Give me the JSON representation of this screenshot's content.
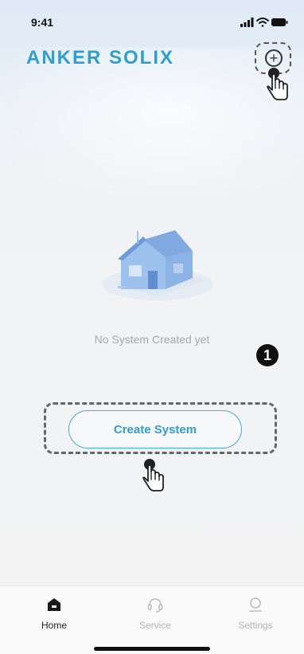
{
  "status_bar": {
    "time": "9:41"
  },
  "header": {
    "logo_text": "ANKER SOLIX",
    "add_icon": "plus-circle-icon"
  },
  "empty_state": {
    "illustration": "house-illustration",
    "message": "No System Created yet",
    "step_badge": "1"
  },
  "create_button": {
    "label": "Create System"
  },
  "tab_bar": {
    "tabs": [
      {
        "label": "Home",
        "icon": "home-icon",
        "active": true
      },
      {
        "label": "Service",
        "icon": "headset-icon",
        "active": false
      },
      {
        "label": "Settings",
        "icon": "settings-icon",
        "active": false
      }
    ]
  },
  "colors": {
    "brand": "#2f9fd0",
    "button_border": "#4aa8dc",
    "muted_text": "#a5a8ae"
  }
}
